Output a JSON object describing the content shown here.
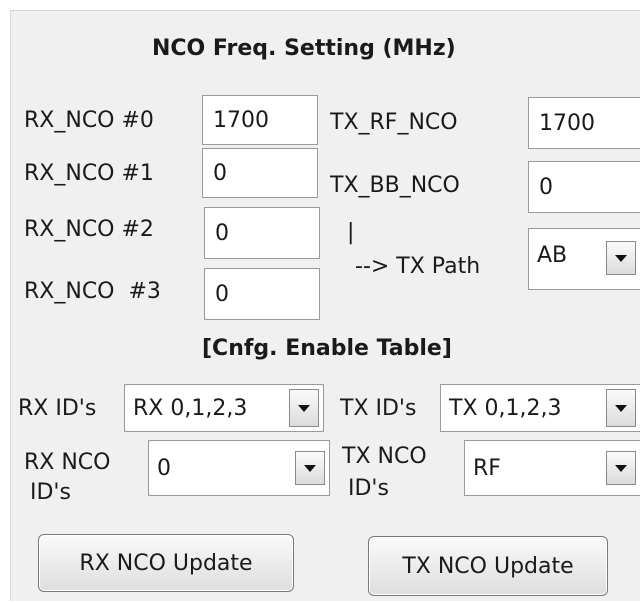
{
  "panel": {
    "title": "NCO Freq. Setting (MHz)",
    "rx": [
      {
        "label": "RX_NCO #0",
        "value": "1700"
      },
      {
        "label": "RX_NCO #1",
        "value": "0"
      },
      {
        "label": "RX_NCO #2",
        "value": "0"
      },
      {
        "label": "RX_NCO  #3",
        "value": "0"
      }
    ],
    "tx_rf": {
      "label": "TX_RF_NCO",
      "value": "1700"
    },
    "tx_bb": {
      "label": "TX_BB_NCO",
      "value": "0"
    },
    "tx_path": {
      "pipe": "|",
      "label": "--> TX Path",
      "value": "AB"
    },
    "enable_table_title": "[Cnfg. Enable Table]",
    "rx_ids": {
      "label": "RX ID's",
      "value": "RX 0,1,2,3"
    },
    "tx_ids": {
      "label": "TX ID's",
      "value": "TX 0,1,2,3"
    },
    "rx_nco_ids": {
      "label_line1": "RX NCO",
      "label_line2": "ID's",
      "value": "0"
    },
    "tx_nco_ids": {
      "label_line1": "TX NCO",
      "label_line2": "ID's",
      "value": "RF"
    },
    "rx_update_button": "RX NCO Update",
    "tx_update_button": "TX NCO Update"
  }
}
